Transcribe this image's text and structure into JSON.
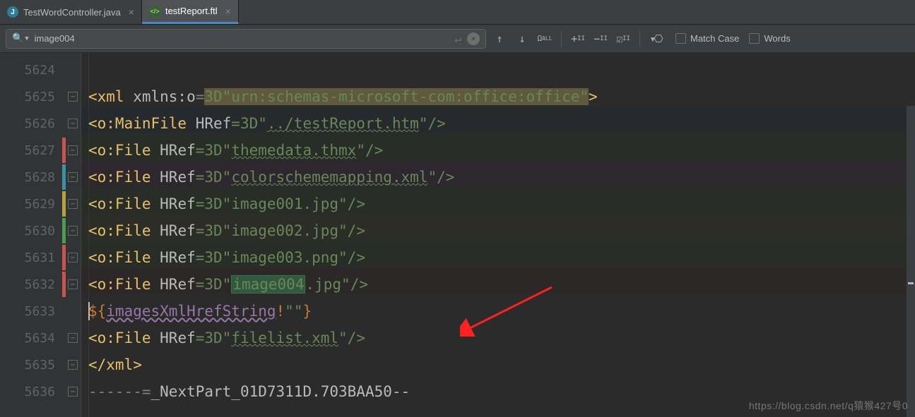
{
  "tabs": [
    {
      "icon": "J",
      "label": "TestWordController.java",
      "active": false
    },
    {
      "icon": "</>",
      "label": "testReport.ftl",
      "active": true
    }
  ],
  "search": {
    "value": "image004",
    "matchCase": "Match Case",
    "words": "Words"
  },
  "lines": [
    {
      "no": "5624"
    },
    {
      "no": "5625"
    },
    {
      "no": "5626"
    },
    {
      "no": "5627"
    },
    {
      "no": "5628"
    },
    {
      "no": "5629"
    },
    {
      "no": "5630"
    },
    {
      "no": "5631"
    },
    {
      "no": "5632"
    },
    {
      "no": "5633"
    },
    {
      "no": "5634"
    },
    {
      "no": "5635"
    },
    {
      "no": "5636"
    }
  ],
  "code": {
    "l5625_open": "<xml",
    "l5625_attr": " xmlns:o",
    "l5625_eq": "=",
    "l5625_val": "3D\"urn:schemas-microsoft-com:office:office\"",
    "l5625_close": ">",
    "l5626_open": "<o:MainFile",
    "l5626_attr": " HRef",
    "l5626_eq": "=3D\"",
    "l5626_str": "../testReport.htm",
    "l5626_end": "\"/>",
    "l5627_open": "<o:File",
    "l5627_attr": " HRef",
    "l5627_eq": "=3D\"",
    "l5627_str": "themedata.thmx",
    "l5627_end": "\"/>",
    "l5628_open": "<o:File",
    "l5628_attr": " HRef",
    "l5628_eq": "=3D\"",
    "l5628_str": "colorschememapping.xml",
    "l5628_end": "\"/>",
    "l5629_open": "<o:File",
    "l5629_attr": " HRef",
    "l5629_eq": "=3D\"",
    "l5629_str": "image001.jpg",
    "l5629_end": "\"/>",
    "l5630_open": "<o:File",
    "l5630_attr": " HRef",
    "l5630_eq": "=3D\"",
    "l5630_str": "image002.jpg",
    "l5630_end": "\"/>",
    "l5631_open": "<o:File",
    "l5631_attr": " HRef",
    "l5631_eq": "=3D\"",
    "l5631_str": "image003.png",
    "l5631_end": "\"/>",
    "l5632_open": "<o:File",
    "l5632_attr": " HRef",
    "l5632_eq": "=3D\"",
    "l5632_hl": "image004",
    "l5632_rest": ".jpg",
    "l5632_end": "\"/>",
    "l5633_ftl1": "${",
    "l5633_var": "imagesXmlHrefString",
    "l5633_excl": "!",
    "l5633_q": "\"\"",
    "l5633_ftl2": "}",
    "l5634_open": "<o:File",
    "l5634_attr": " HRef",
    "l5634_eq": "=3D\"",
    "l5634_str": "filelist.xml",
    "l5634_end": "\"/>",
    "l5635": "</xml>",
    "l5636_dash": "------=",
    "l5636_rest": "_NextPart_01D7311D.703BAA50--"
  },
  "watermark": "https://blog.csdn.net/q猿猴427号0"
}
